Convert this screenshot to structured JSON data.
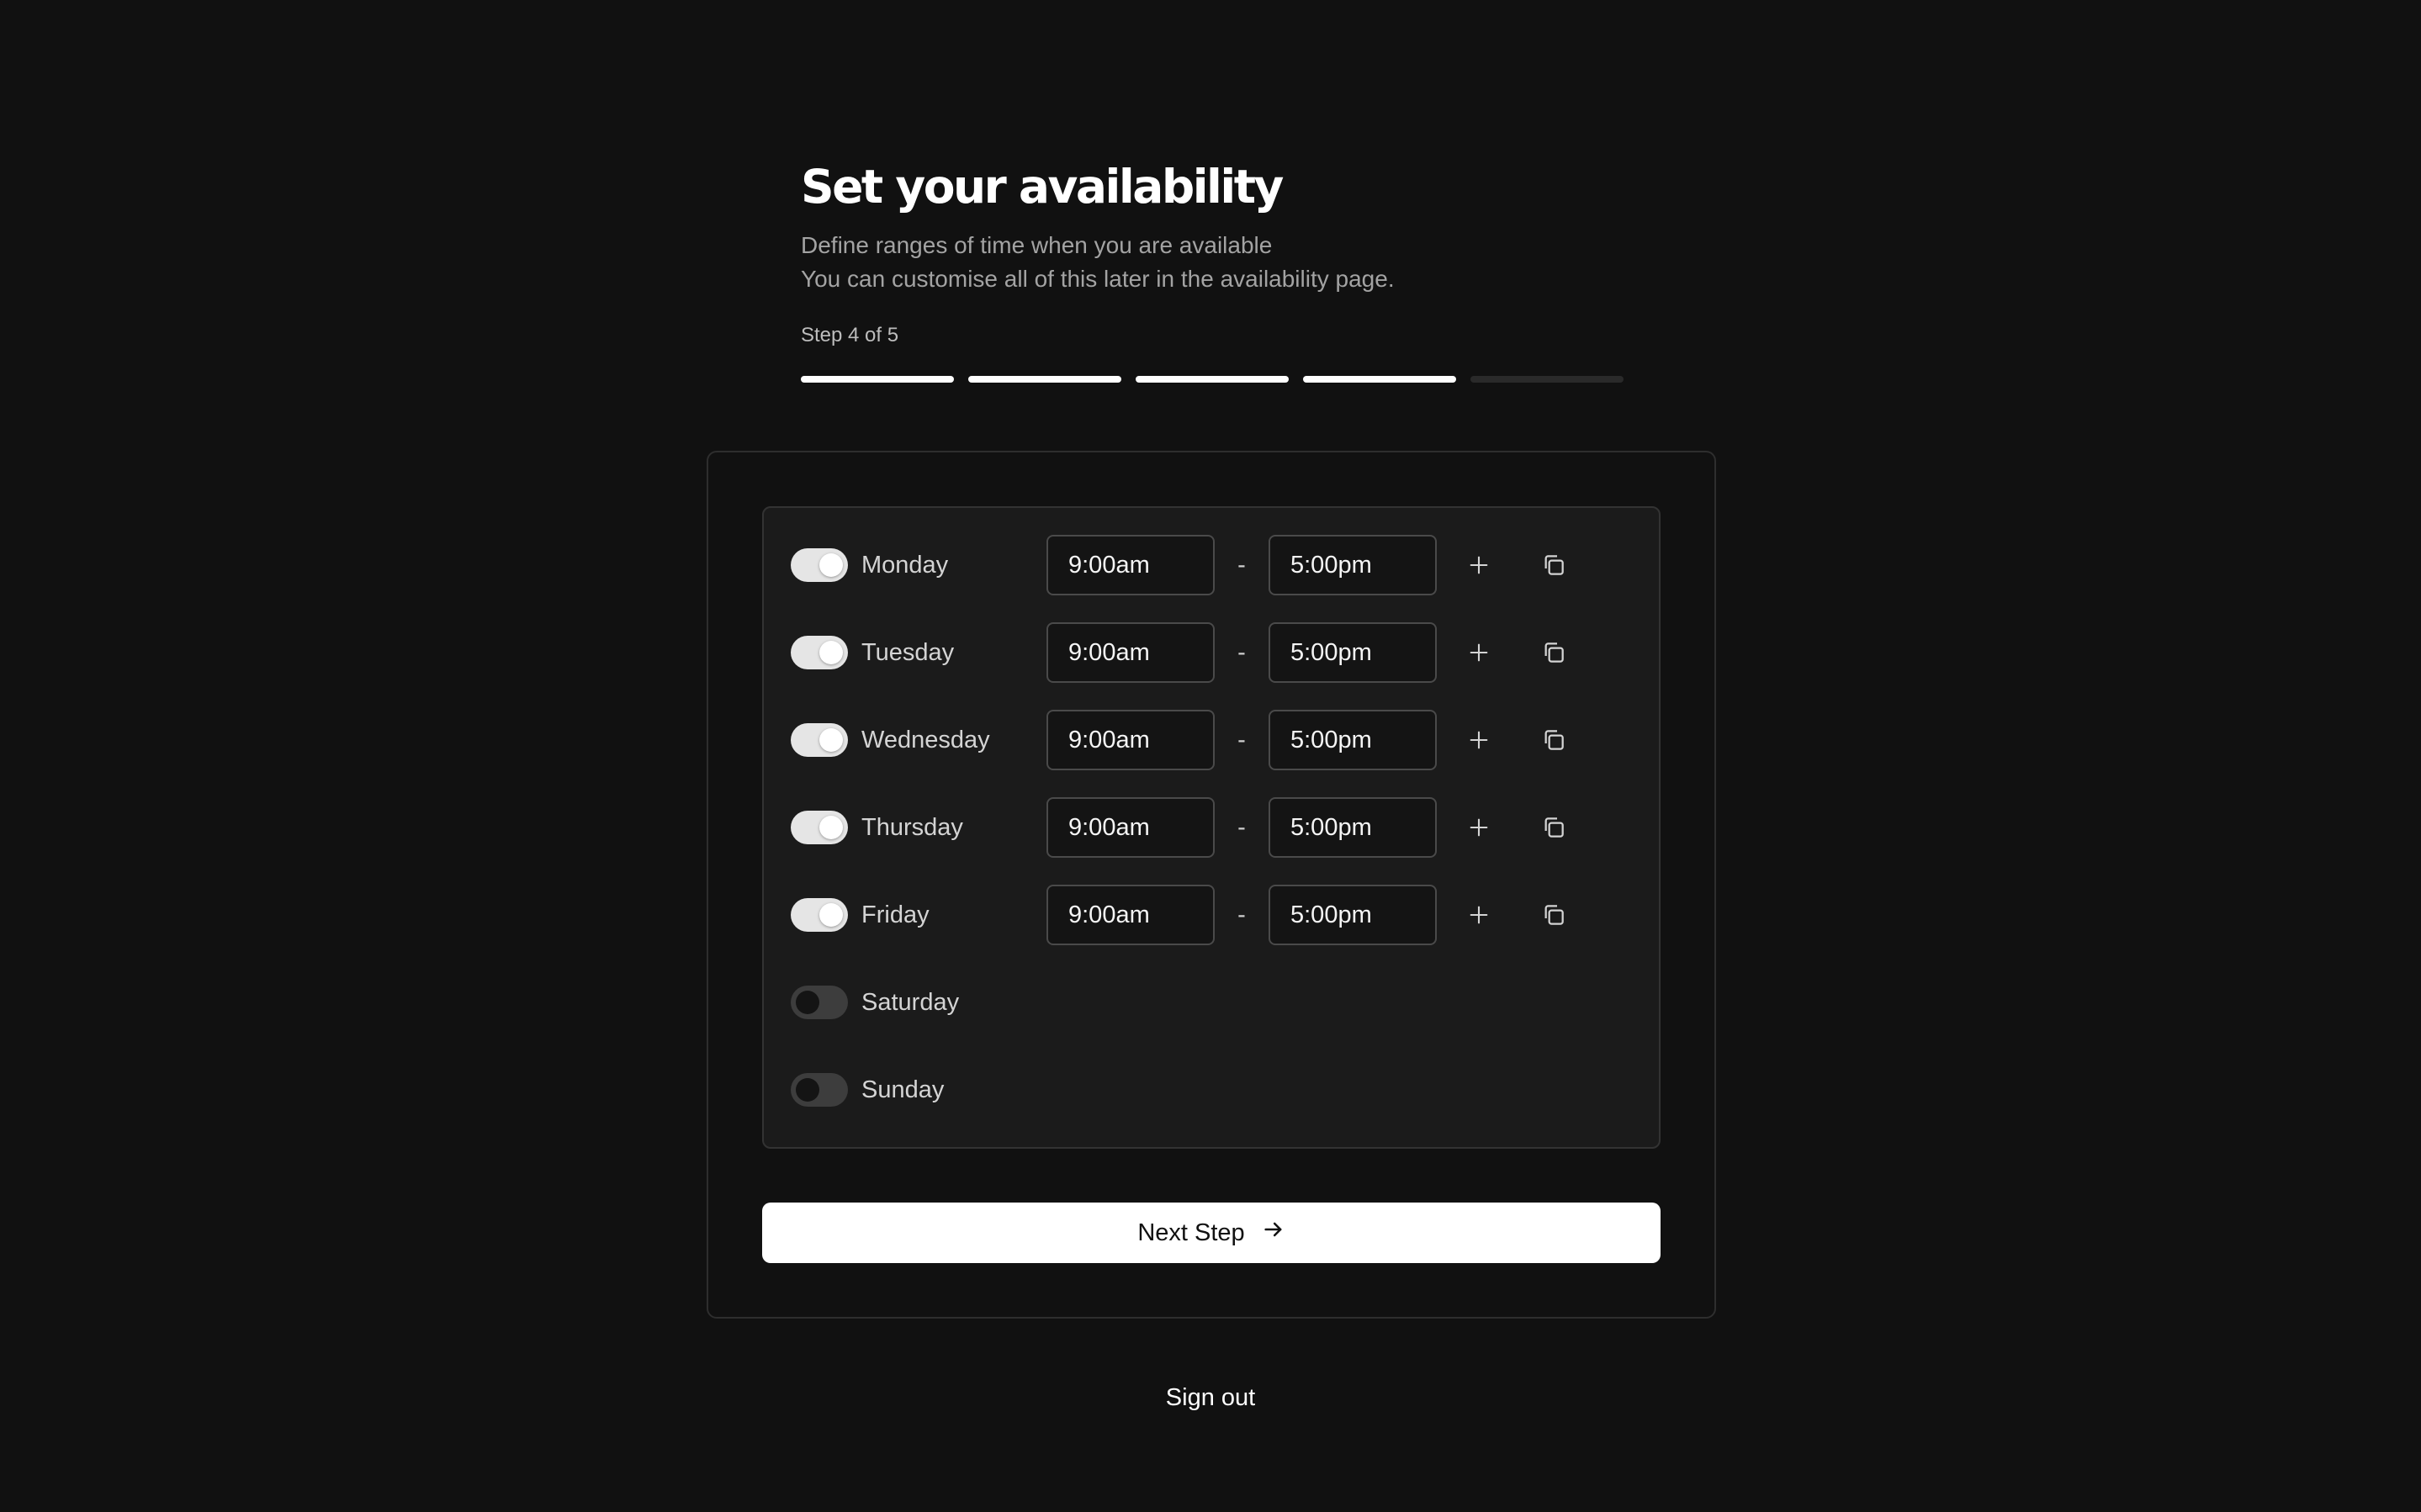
{
  "header": {
    "title": "Set your availability",
    "subtitle_line1": "Define ranges of time when you are available",
    "subtitle_line2": "You can customise all of this later in the availability page.",
    "step_label": "Step 4 of 5",
    "progress": {
      "current_step": 4,
      "total_steps": 5
    }
  },
  "schedule": {
    "days": [
      {
        "name": "Monday",
        "enabled": true,
        "start": "9:00am",
        "end": "5:00pm"
      },
      {
        "name": "Tuesday",
        "enabled": true,
        "start": "9:00am",
        "end": "5:00pm"
      },
      {
        "name": "Wednesday",
        "enabled": true,
        "start": "9:00am",
        "end": "5:00pm"
      },
      {
        "name": "Thursday",
        "enabled": true,
        "start": "9:00am",
        "end": "5:00pm"
      },
      {
        "name": "Friday",
        "enabled": true,
        "start": "9:00am",
        "end": "5:00pm"
      },
      {
        "name": "Saturday",
        "enabled": false
      },
      {
        "name": "Sunday",
        "enabled": false
      }
    ],
    "range_separator": "-",
    "icons": {
      "add": "plus-icon",
      "copy": "copy-icon",
      "next": "arrow-right-icon"
    }
  },
  "actions": {
    "next_label": "Next Step",
    "signout_label": "Sign out"
  },
  "colors": {
    "background": "#111111",
    "panel": "#1b1b1b",
    "toggle_on": "#e5e5e5",
    "toggle_off": "#3d3d3d",
    "button": "#ffffff"
  }
}
